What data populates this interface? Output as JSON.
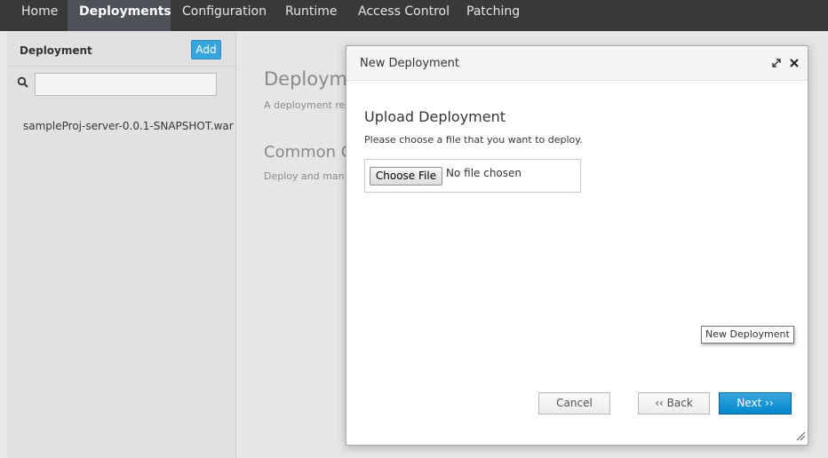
{
  "nav": {
    "items": [
      {
        "label": "Home"
      },
      {
        "label": "Deployments"
      },
      {
        "label": "Configuration"
      },
      {
        "label": "Runtime"
      },
      {
        "label": "Access Control"
      },
      {
        "label": "Patching"
      }
    ]
  },
  "sidebar": {
    "title": "Deployment",
    "add_label": "Add",
    "search_placeholder": "",
    "items": [
      {
        "label": "sampleProj-server-0.0.1-SNAPSHOT.war"
      }
    ]
  },
  "main": {
    "title": "Deploym",
    "description": "A deployment re kind of standard",
    "subtitle": "Common C",
    "subdescription": "Deploy and man"
  },
  "modal": {
    "title": "New Deployment",
    "heading": "Upload Deployment",
    "instruction": "Please choose a file that you want to deploy.",
    "choose_file_label": "Choose File",
    "file_status": "No file chosen",
    "tooltip": "New Deployment",
    "cancel_label": "Cancel",
    "back_label": "‹‹ Back",
    "next_label": "Next ››"
  },
  "colors": {
    "topbar": "#393939",
    "active_tab": "#4d5258",
    "accent": "#39a5dc",
    "primary_button": "#0088ce"
  },
  "icons": [
    "search-icon",
    "maximize-icon",
    "close-icon",
    "resize-grip-icon"
  ]
}
